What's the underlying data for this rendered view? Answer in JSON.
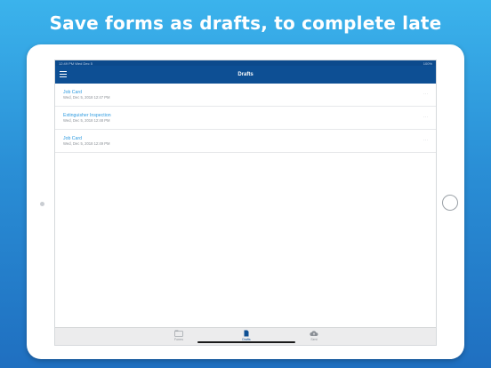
{
  "headline": "Save forms as drafts, to complete late",
  "status_bar": {
    "left": "12:49 PM  Wed Dec 5",
    "right": "100%"
  },
  "nav": {
    "title": "Drafts"
  },
  "drafts": [
    {
      "title": "Job Card",
      "date": "Wed, Dec 5, 2018 12:47 PM",
      "more": "···"
    },
    {
      "title": "Extinguisher Inspection",
      "date": "Wed, Dec 5, 2018 12:48 PM",
      "more": "···"
    },
    {
      "title": "Job Card",
      "date": "Wed, Dec 5, 2018 12:49 PM",
      "more": "···"
    }
  ],
  "tabs": [
    {
      "label": "Forms",
      "icon": "folder-icon"
    },
    {
      "label": "Drafts",
      "icon": "document-icon",
      "active": true
    },
    {
      "label": "Sent",
      "icon": "cloud-upload-icon"
    }
  ],
  "colors": {
    "nav_bar": "#0d4f94",
    "link_blue": "#2e9be0",
    "background_top": "#3bb3ec",
    "background_bottom": "#1f6fc0"
  }
}
